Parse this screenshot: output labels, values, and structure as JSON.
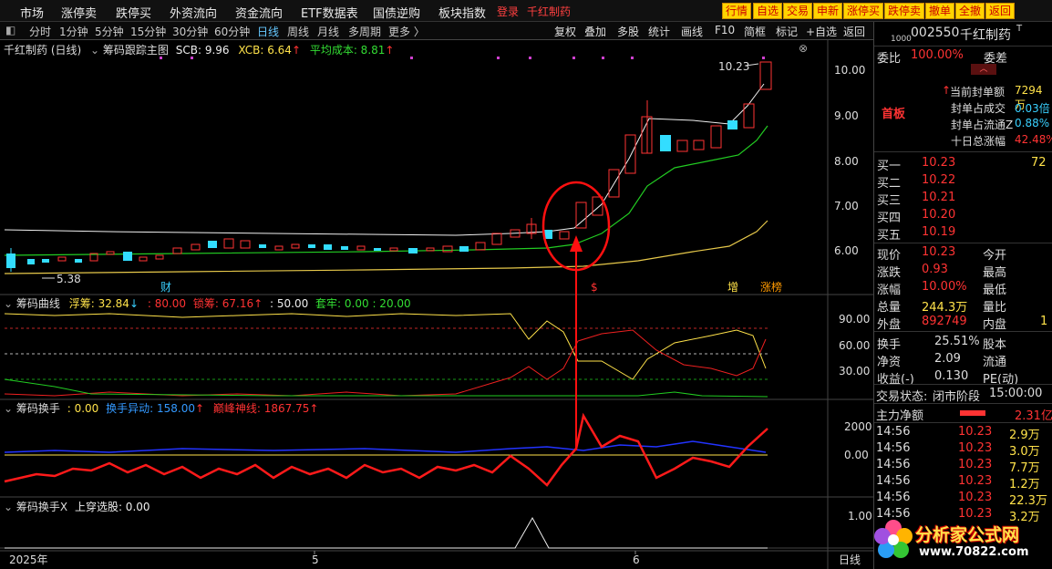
{
  "menubar": {
    "items": [
      "市场",
      "涨停卖",
      "跌停买",
      "外资流向",
      "资金流向",
      "ETF数据表",
      "国债逆购",
      "板块指数"
    ],
    "login": "登录",
    "stock": "千红制药",
    "buttons": [
      "行情",
      "自选",
      "交易",
      "申新",
      "涨停买",
      "跌停卖",
      "撤单",
      "全撤",
      "返回"
    ]
  },
  "toolbar": {
    "periods": [
      "分时",
      "1分钟",
      "5分钟",
      "15分钟",
      "30分钟",
      "60分钟",
      "日线",
      "周线",
      "月线",
      "多周期",
      "更多 〉"
    ],
    "active_period": "日线",
    "tools": [
      "复权",
      "叠加",
      "多股",
      "统计",
      "画线",
      "F10",
      "简框",
      "标记",
      "+自选",
      "返回"
    ]
  },
  "main_panel": {
    "title": "千红制药 (日线)",
    "indicator": "筹码跟踪主图",
    "scb_label": "SCB: 9.96",
    "xcb_label": "XCB: 6.64",
    "avg_cost_label": "平均成本: 8.81",
    "up_arrow": "↑",
    "y_ticks": [
      "10.00",
      "9.00",
      "8.00",
      "7.00",
      "6.00"
    ],
    "high_label": "10.23",
    "low_label": "5.38",
    "markers": [
      "财",
      "$",
      "增",
      "涨榜"
    ]
  },
  "curve_panel": {
    "title": "筹码曲线",
    "float_label": "浮筹: 32.84",
    "down_arrow": "↓",
    "v80": ": 80.00",
    "lock_label": "锁筹: 67.16",
    "v50": ": 50.00",
    "trap_label": "套牢: 0.00",
    "v20": ": 20.00",
    "y_ticks": [
      "90.00",
      "60.00",
      "30.00"
    ]
  },
  "turnover_panel": {
    "title": "筹码换手",
    "v0": ": 0.00",
    "abnormal_label": "换手异动: 158.00",
    "peak_label": "巅峰神线: 1867.75",
    "y_ticks": [
      "2000",
      "0.00"
    ]
  },
  "cross_panel": {
    "title": "筹码换手X",
    "signal_label": "上穿选股: 0.00",
    "y_ticks": [
      "1.00"
    ]
  },
  "time_axis": {
    "labels": [
      "2025年",
      "5",
      "6"
    ],
    "period": "日线"
  },
  "quote": {
    "code": "002550",
    "name": "千红制药",
    "small_tag": "1000",
    "weibi_label": "委比",
    "weibi_value": "100.00%",
    "weicha_label": "委差",
    "first_board": "首板",
    "seal_label": "当前封单额",
    "seal_value": "7294万",
    "seal_deal_label": "封单占成交",
    "seal_deal_value": "0.03倍",
    "seal_float_label": "封单占流通Z",
    "seal_float_value": "0.88%",
    "ten_day_label": "十日总涨幅",
    "ten_day_value": "42.48%",
    "bids": [
      {
        "label": "买一",
        "price": "10.23",
        "vol": "72"
      },
      {
        "label": "买二",
        "price": "10.22",
        "vol": ""
      },
      {
        "label": "买三",
        "price": "10.21",
        "vol": ""
      },
      {
        "label": "买四",
        "price": "10.20",
        "vol": ""
      },
      {
        "label": "买五",
        "price": "10.19",
        "vol": ""
      }
    ],
    "stats": [
      {
        "l1": "现价",
        "v1": "10.23",
        "c1": "#ff3333",
        "l2": "今开",
        "v2": ""
      },
      {
        "l1": "涨跌",
        "v1": "0.93",
        "c1": "#ff3333",
        "l2": "最高",
        "v2": ""
      },
      {
        "l1": "涨幅",
        "v1": "10.00%",
        "c1": "#ff3333",
        "l2": "最低",
        "v2": ""
      },
      {
        "l1": "总量",
        "v1": "244.3万",
        "c1": "#ffe24a",
        "l2": "量比",
        "v2": ""
      },
      {
        "l1": "外盘",
        "v1": "892749",
        "c1": "#ff3333",
        "l2": "内盘",
        "v2": "1"
      }
    ],
    "stats2": [
      {
        "l1": "换手",
        "v1": "25.51%",
        "l2": "股本"
      },
      {
        "l1": "净资",
        "v1": "2.09",
        "l2": "流通"
      },
      {
        "l1": "收益(-)",
        "v1": "0.130",
        "l2": "PE(动)"
      }
    ],
    "trade_status_label": "交易状态:",
    "trade_status": "闭市阶段",
    "trade_time": "15:00:00",
    "main_net_label": "主力净额",
    "main_net_value": "2.31亿",
    "ticks": [
      {
        "time": "14:56",
        "price": "10.23",
        "vol": "2.9万"
      },
      {
        "time": "14:56",
        "price": "10.23",
        "vol": "3.0万"
      },
      {
        "time": "14:56",
        "price": "10.23",
        "vol": "7.7万"
      },
      {
        "time": "14:56",
        "price": "10.23",
        "vol": "1.2万"
      },
      {
        "time": "14:56",
        "price": "10.23",
        "vol": "22.3万"
      },
      {
        "time": "14:56",
        "price": "10.23",
        "vol": "3.2万"
      }
    ]
  },
  "watermark": {
    "text": "分析家公式网",
    "url": "www.70822.com"
  },
  "colors": {
    "up": "#ff3333",
    "down": "#33ddff",
    "yellow": "#ffe24a",
    "green": "#33dd33",
    "blue": "#3355ff",
    "annot": "#ff1010"
  }
}
